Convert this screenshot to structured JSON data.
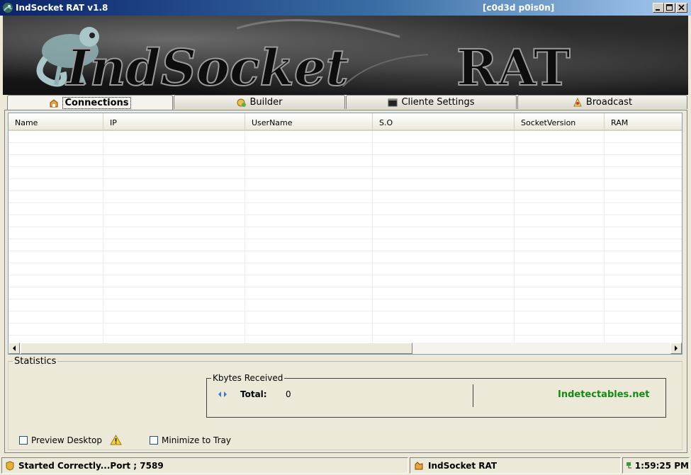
{
  "window": {
    "title": "IndSocket RAT v1.8",
    "subtitle": "[c0d3d p0is0n]"
  },
  "banner": {
    "logo_text": "IndSocket RAT",
    "mascot": "chameleon"
  },
  "tabs": [
    {
      "label": "Connections",
      "icon": "connections-icon",
      "active": true
    },
    {
      "label": "Builder",
      "icon": "builder-icon",
      "active": false
    },
    {
      "label": "Cliente Settings",
      "icon": "terminal-icon",
      "active": false
    },
    {
      "label": "Broadcast",
      "icon": "broadcast-icon",
      "active": false
    }
  ],
  "connections": {
    "columns": [
      "Name",
      "IP",
      "UserName",
      "S.O",
      "SocketVersion",
      "RAM"
    ],
    "rows": []
  },
  "statistics": {
    "label": "Statistics",
    "kbytes_label": "Kbytes Received",
    "total_label": "Total:",
    "total_value": "0",
    "link": "Indetectables.net",
    "preview_desktop": {
      "label": "Preview Desktop",
      "checked": false
    },
    "minimize_tray": {
      "label": "Minimize to Tray",
      "checked": false
    }
  },
  "statusbar": {
    "status": "Started Correctly...Port ; 7589",
    "app": "IndSocket RAT",
    "time": "1:59:25 PM"
  },
  "colors": {
    "link_green": "#148a14",
    "titlebar_start": "#0a246a",
    "titlebar_end": "#a6caf0"
  }
}
